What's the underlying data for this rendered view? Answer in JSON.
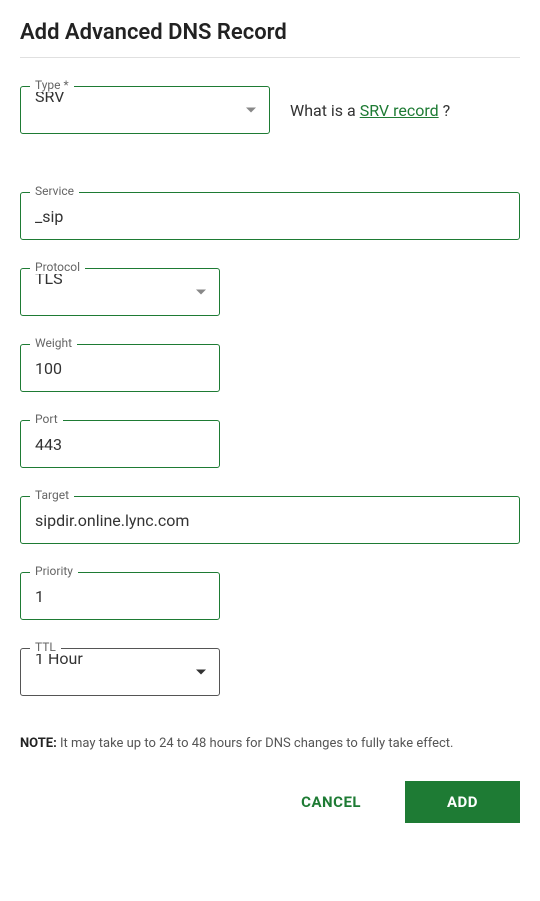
{
  "title": "Add Advanced DNS Record",
  "fields": {
    "type": {
      "label": "Type *",
      "value": "SRV"
    },
    "help": {
      "prefix": "What is a ",
      "link_text": "SRV record",
      "suffix": " ?"
    },
    "service": {
      "label": "Service",
      "value": "_sip"
    },
    "protocol": {
      "label": "Protocol",
      "value": "TLS"
    },
    "weight": {
      "label": "Weight",
      "value": "100"
    },
    "port": {
      "label": "Port",
      "value": "443"
    },
    "target": {
      "label": "Target",
      "value": "sipdir.online.lync.com"
    },
    "priority": {
      "label": "Priority",
      "value": "1"
    },
    "ttl": {
      "label": "TTL",
      "value": "1 Hour"
    }
  },
  "note": {
    "label": "NOTE:",
    "text": " It may take up to 24 to 48 hours for DNS changes to fully take effect."
  },
  "buttons": {
    "cancel": "CANCEL",
    "add": "ADD"
  }
}
